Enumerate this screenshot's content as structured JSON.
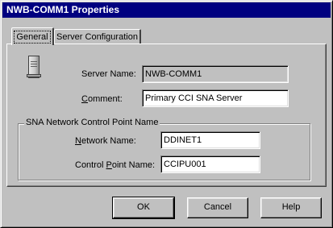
{
  "window": {
    "title": "NWB-COMM1 Properties"
  },
  "tabs": [
    {
      "label": "General",
      "active": true
    },
    {
      "label": "Server Configuration",
      "active": false
    }
  ],
  "general": {
    "server_name_label": "Server Name:",
    "server_name_value": "NWB-COMM1",
    "comment_label_mnemonic": "C",
    "comment_label_rest": "omment:",
    "comment_value": "Primary CCI SNA Server",
    "group_title": "SNA Network Control Point Name",
    "network_name_label_mnemonic": "N",
    "network_name_label_rest": "etwork Name:",
    "network_name_value": "DDINET1",
    "cp_name_label_prefix": "Control ",
    "cp_name_label_mnemonic": "P",
    "cp_name_label_rest": "oint Name:",
    "cp_name_value": "CCIPU001"
  },
  "buttons": {
    "ok": "OK",
    "cancel": "Cancel",
    "help": "Help"
  },
  "icons": {
    "server": "server-icon"
  }
}
